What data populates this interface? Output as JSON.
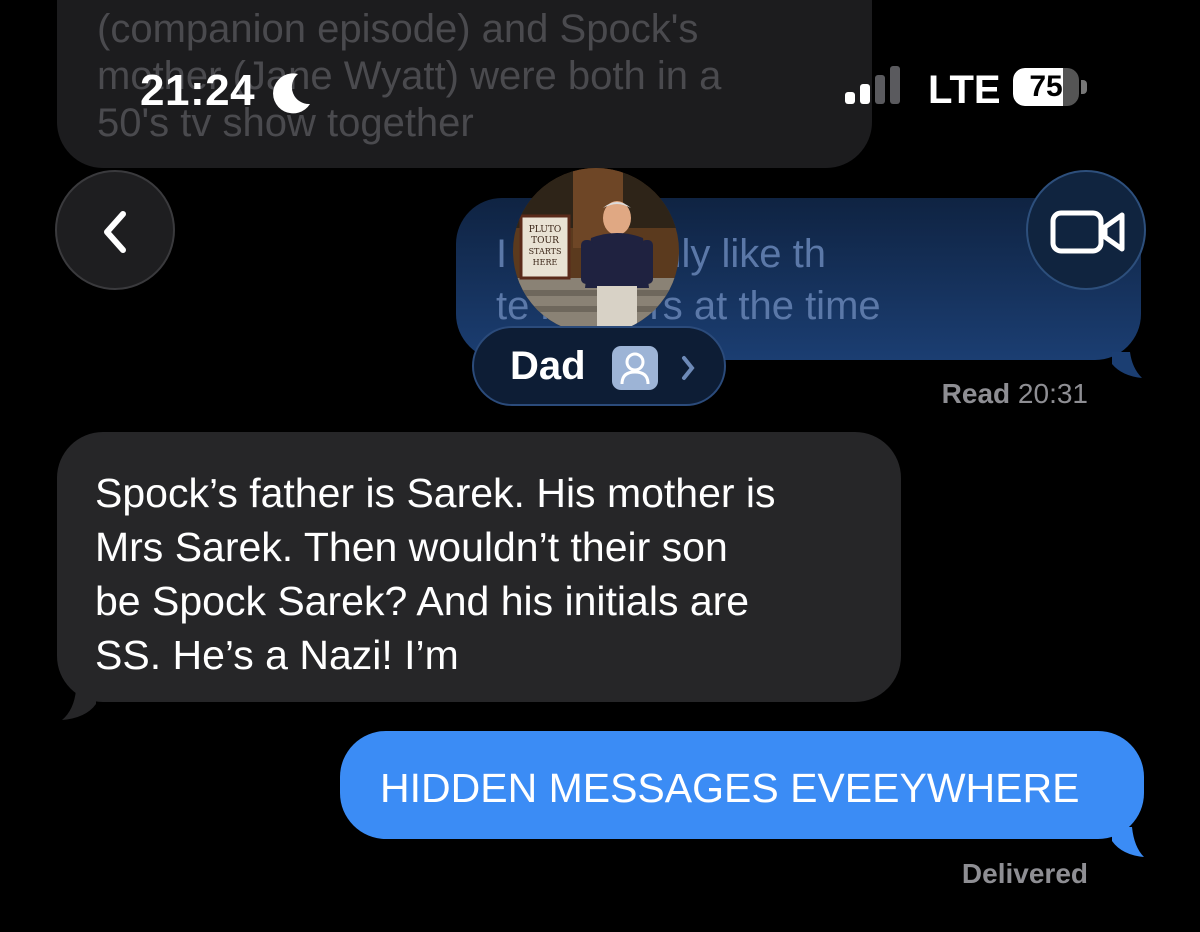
{
  "status_bar": {
    "time": "21:24",
    "network": "LTE",
    "battery_level": "75",
    "battery_fraction": 0.75
  },
  "header": {
    "contact_name": "Dad",
    "back_icon": "chevron-left-icon",
    "video_icon": "video-camera-icon",
    "avatar_sign_text": [
      "PLUTO",
      "TOUR",
      "STARTS",
      "HERE"
    ]
  },
  "messages": {
    "previous_incoming_lines": [
      "(companion episode) and Spock's",
      "mother (Jane Wyatt) were both in a",
      "50's tv show together"
    ],
    "previous_outgoing_lines": [
      "I          here's only like th",
      "te          n actors at the time"
    ],
    "read_status": "Read",
    "read_time": "20:31",
    "incoming_lines": [
      "Spock’s father is Sarek. His mother is",
      "Mrs Sarek. Then wouldn’t their son",
      "be Spock Sarek?  And his initials are",
      "SS. He’s a Nazi! I’m"
    ],
    "outgoing_text": "HIDDEN MESSAGES EVEEYWHERE",
    "delivery_status": "Delivered"
  },
  "colors": {
    "background": "#000000",
    "incoming_bubble": "#262628",
    "outgoing_bubble": "#3b8cf5",
    "receipt_text": "#8e8e93"
  }
}
